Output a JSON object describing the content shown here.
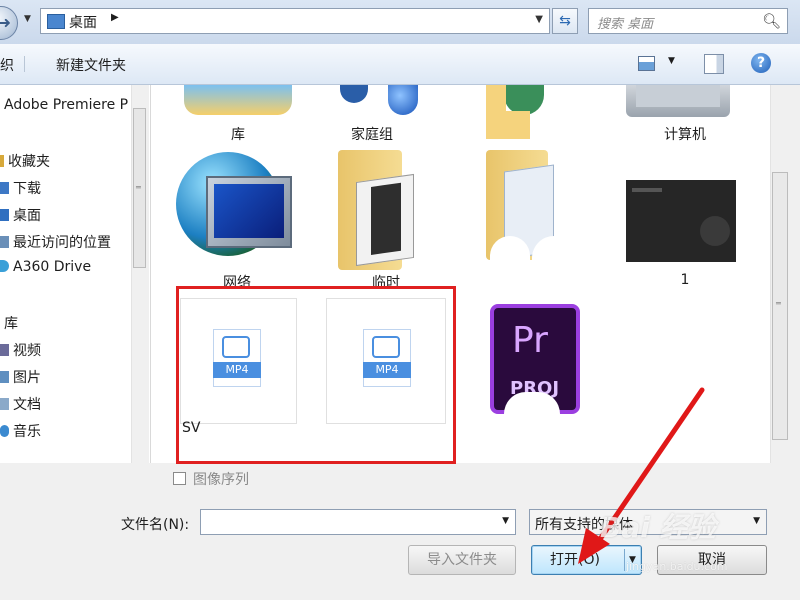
{
  "address": {
    "location": "桌面",
    "search_placeholder": "搜索 桌面"
  },
  "toolbar": {
    "cut_label": "织",
    "new_folder": "新建文件夹"
  },
  "sidebar": {
    "items": [
      {
        "label": "Adobe Premiere P",
        "icon": "none"
      },
      {
        "label": "收藏夹",
        "icon": "star-icon"
      },
      {
        "label": "下载",
        "icon": "download-folder-icon"
      },
      {
        "label": "桌面",
        "icon": "desktop-icon"
      },
      {
        "label": "最近访问的位置",
        "icon": "recent-places-icon"
      },
      {
        "label": "A360 Drive",
        "icon": "cloud-drive-icon"
      },
      {
        "label": "库",
        "icon": "library-icon"
      },
      {
        "label": "视频",
        "icon": "video-library-icon"
      },
      {
        "label": "图片",
        "icon": "pictures-library-icon"
      },
      {
        "label": "文档",
        "icon": "documents-library-icon"
      },
      {
        "label": "音乐",
        "icon": "music-library-icon"
      }
    ]
  },
  "tiles": {
    "library": "库",
    "homegroup": "家庭组",
    "computer": "计算机",
    "network": "网络",
    "temp": "临时",
    "image1": "1",
    "mp4_1_name": "SV",
    "mp4_badge": "MP4",
    "pr_badge": "Pr",
    "proj_badge": "PROJ"
  },
  "bottom": {
    "image_sequence": "图像序列",
    "filename_label": "文件名(N):",
    "filename_value": "",
    "filter_value": "所有支持的媒体",
    "import_folder": "导入文件夹",
    "open": "打开(O)",
    "cancel": "取消"
  },
  "watermark": {
    "brand": "Bai 经验",
    "url": "jingyan.baidu.com"
  },
  "colors": {
    "highlight": "#e02020",
    "pr_purple": "#2a0a3d",
    "pr_accent": "#9b3fe0",
    "mp4_blue": "#4a8fe0"
  }
}
